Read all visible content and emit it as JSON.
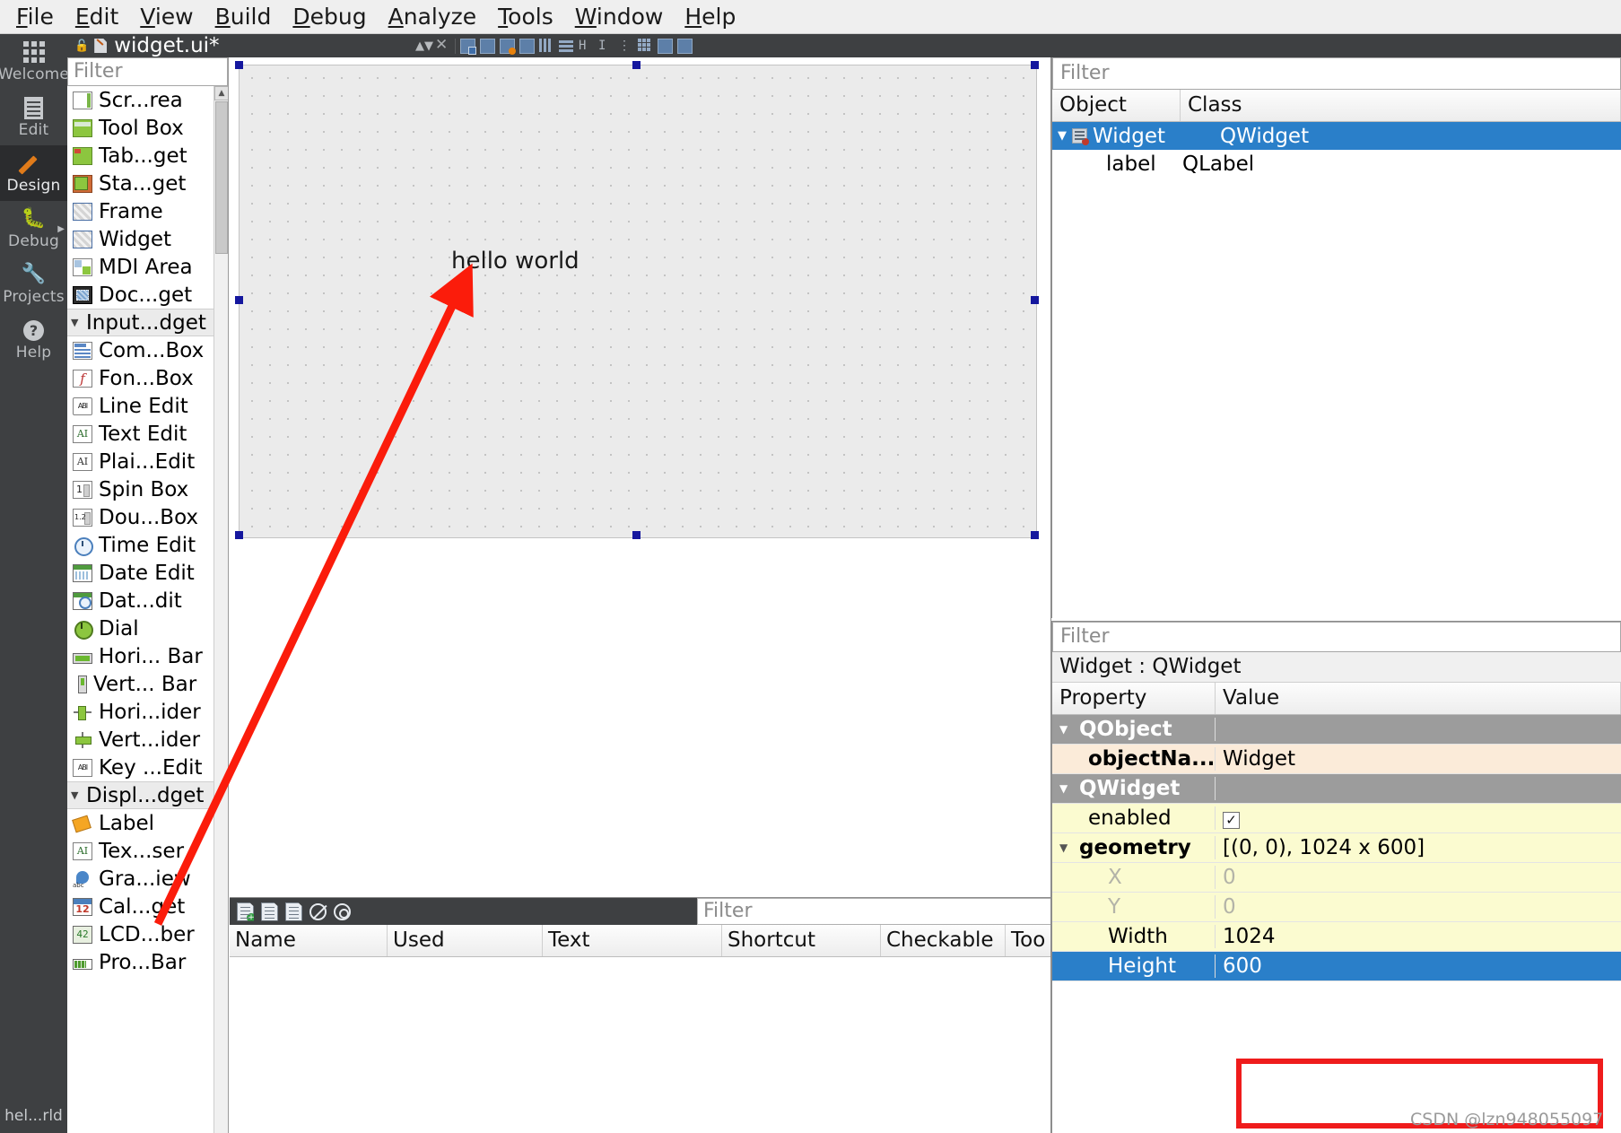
{
  "menu": {
    "items": [
      {
        "accel": "F",
        "rest": "ile"
      },
      {
        "accel": "E",
        "rest": "dit"
      },
      {
        "accel": "V",
        "rest": "iew"
      },
      {
        "accel": "B",
        "rest": "uild"
      },
      {
        "accel": "D",
        "rest": "ebug"
      },
      {
        "accel": "A",
        "rest": "nalyze"
      },
      {
        "accel": "T",
        "rest": "ools"
      },
      {
        "accel": "W",
        "rest": "indow"
      },
      {
        "accel": "H",
        "rest": "elp"
      }
    ]
  },
  "activity_bar": {
    "items": [
      {
        "label": "Welcome",
        "icon": "grid-icon",
        "active": false
      },
      {
        "label": "Edit",
        "icon": "document-icon",
        "active": false
      },
      {
        "label": "Design",
        "icon": "pencil-icon",
        "active": true
      },
      {
        "label": "Debug",
        "icon": "bug-icon",
        "active": false
      },
      {
        "label": "Projects",
        "icon": "wrench-icon",
        "active": false
      },
      {
        "label": "Help",
        "icon": "question-mark-icon",
        "active": false
      }
    ],
    "status": "hel...rld"
  },
  "editor_tab": {
    "title": "widget.ui*",
    "lock_icon": "unlocked-padlock-icon",
    "file_icon": "ui-file-icon"
  },
  "widget_box": {
    "filter_placeholder": "Filter",
    "items": [
      {
        "label": "Scr...rea",
        "icon": "scroll-area-icon",
        "type": "item",
        "ic": "ic-scroll"
      },
      {
        "label": "Tool Box",
        "icon": "tool-box-icon",
        "type": "item",
        "ic": "ic-toolbox"
      },
      {
        "label": "Tab...get",
        "icon": "tab-widget-icon",
        "type": "item",
        "ic": "ic-tab"
      },
      {
        "label": "Sta...get",
        "icon": "stacked-widget-icon",
        "type": "item",
        "ic": "ic-stack"
      },
      {
        "label": "Frame",
        "icon": "frame-icon",
        "type": "item",
        "ic": "ic-frame"
      },
      {
        "label": "Widget",
        "icon": "widget-icon",
        "type": "item",
        "ic": "ic-frame"
      },
      {
        "label": "MDI Area",
        "icon": "mdi-area-icon",
        "type": "item",
        "ic": "ic-mdi"
      },
      {
        "label": "Doc...get",
        "icon": "dock-widget-icon",
        "type": "item",
        "ic": "ic-dock"
      },
      {
        "label": "Input...dget",
        "icon": "chevron-down-icon",
        "type": "group",
        "ic": ""
      },
      {
        "label": "Com...Box",
        "icon": "combo-box-icon",
        "type": "item",
        "ic": "ic-combo"
      },
      {
        "label": "Fon...Box",
        "icon": "font-combo-box-icon",
        "type": "item",
        "ic": "ic-font"
      },
      {
        "label": "Line Edit",
        "icon": "line-edit-icon",
        "type": "item",
        "ic": "ic-line"
      },
      {
        "label": "Text Edit",
        "icon": "text-edit-icon",
        "type": "item",
        "ic": "ic-text"
      },
      {
        "label": "Plai...Edit",
        "icon": "plain-text-edit-icon",
        "type": "item",
        "ic": "ic-plain"
      },
      {
        "label": "Spin Box",
        "icon": "spin-box-icon",
        "type": "item",
        "ic": "ic-spin"
      },
      {
        "label": "Dou...Box",
        "icon": "double-spin-box-icon",
        "type": "item",
        "ic": "ic-dspin"
      },
      {
        "label": "Time Edit",
        "icon": "time-edit-icon",
        "type": "item",
        "ic": "ic-clock"
      },
      {
        "label": "Date Edit",
        "icon": "date-edit-icon",
        "type": "item",
        "ic": "ic-cal"
      },
      {
        "label": "Dat...dit",
        "icon": "date-time-edit-icon",
        "type": "item",
        "ic": "ic-caldate"
      },
      {
        "label": "Dial",
        "icon": "dial-icon",
        "type": "item",
        "ic": "ic-dial"
      },
      {
        "label": "Hori... Bar",
        "icon": "horizontal-scroll-bar-icon",
        "type": "item",
        "ic": "ic-hbar"
      },
      {
        "label": "Vert... Bar",
        "icon": "vertical-scroll-bar-icon",
        "type": "item",
        "ic": "ic-vbar"
      },
      {
        "label": "Hori...ider",
        "icon": "horizontal-slider-icon",
        "type": "item",
        "ic": "ic-hslider"
      },
      {
        "label": "Vert...ider",
        "icon": "vertical-slider-icon",
        "type": "item",
        "ic": "ic-vslider"
      },
      {
        "label": "Key ...Edit",
        "icon": "key-sequence-edit-icon",
        "type": "item",
        "ic": "ic-key"
      },
      {
        "label": "Displ...dget",
        "icon": "chevron-down-icon",
        "type": "group",
        "ic": ""
      },
      {
        "label": "Label",
        "icon": "label-icon",
        "type": "item",
        "ic": "ic-label"
      },
      {
        "label": "Tex...ser",
        "icon": "text-browser-icon",
        "type": "item",
        "ic": "ic-browser"
      },
      {
        "label": "Gra...iew",
        "icon": "graphics-view-icon",
        "type": "item",
        "ic": "ic-gfx"
      },
      {
        "label": "Cal...get",
        "icon": "calendar-widget-icon",
        "type": "item",
        "ic": "ic-cal12"
      },
      {
        "label": "LCD...ber",
        "icon": "lcd-number-icon",
        "type": "item",
        "ic": "ic-lcd"
      },
      {
        "label": "Pro...Bar",
        "icon": "progress-bar-icon",
        "type": "item",
        "ic": "ic-prog"
      }
    ]
  },
  "form_canvas": {
    "label_text": "hello world"
  },
  "action_editor": {
    "toolbar_icons": [
      "new-action-icon",
      "copy-action-icon",
      "paste-action-icon",
      "delete-action-icon",
      "navigate-action-icon"
    ],
    "filter_placeholder": "Filter",
    "columns": [
      "Name",
      "Used",
      "Text",
      "Shortcut",
      "Checkable",
      "Too"
    ],
    "rows": []
  },
  "object_inspector": {
    "filter_placeholder": "Filter",
    "columns": [
      "Object",
      "Class"
    ],
    "rows": [
      {
        "object": "Widget",
        "class": "QWidget",
        "selected": true,
        "expandable": true,
        "indent": 0
      },
      {
        "object": "label",
        "class": "QLabel",
        "selected": false,
        "expandable": false,
        "indent": 1
      }
    ]
  },
  "property_editor": {
    "filter_placeholder": "Filter",
    "subject": "Widget : QWidget",
    "columns": [
      "Property",
      "Value"
    ],
    "rows": [
      {
        "property": "QObject",
        "value": "",
        "style": "group",
        "expandable": true,
        "indent": 0
      },
      {
        "property": "objectNa...",
        "value": "Widget",
        "style": "cream",
        "expandable": false,
        "indent": 1,
        "bold": true
      },
      {
        "property": "QWidget",
        "value": "",
        "style": "group",
        "expandable": true,
        "indent": 0
      },
      {
        "property": "enabled",
        "value": "",
        "style": "yellow",
        "expandable": false,
        "indent": 1,
        "checkbox": true,
        "checked": true
      },
      {
        "property": "geometry",
        "value": "[(0, 0), 1024 x 600]",
        "style": "yellow",
        "expandable": true,
        "indent": 0,
        "bold": true
      },
      {
        "property": "X",
        "value": "0",
        "style": "yellow-dim",
        "expandable": false,
        "indent": 2
      },
      {
        "property": "Y",
        "value": "0",
        "style": "yellow-dim",
        "expandable": false,
        "indent": 2
      },
      {
        "property": "Width",
        "value": "1024",
        "style": "yellow",
        "expandable": false,
        "indent": 2
      },
      {
        "property": "Height",
        "value": "600",
        "style": "selected",
        "expandable": false,
        "indent": 2
      }
    ]
  },
  "annotations": {
    "watermark": "CSDN @lzn948055097",
    "highlight_color": "#ef1c1c",
    "arrow_color": "#fb1c0b"
  }
}
